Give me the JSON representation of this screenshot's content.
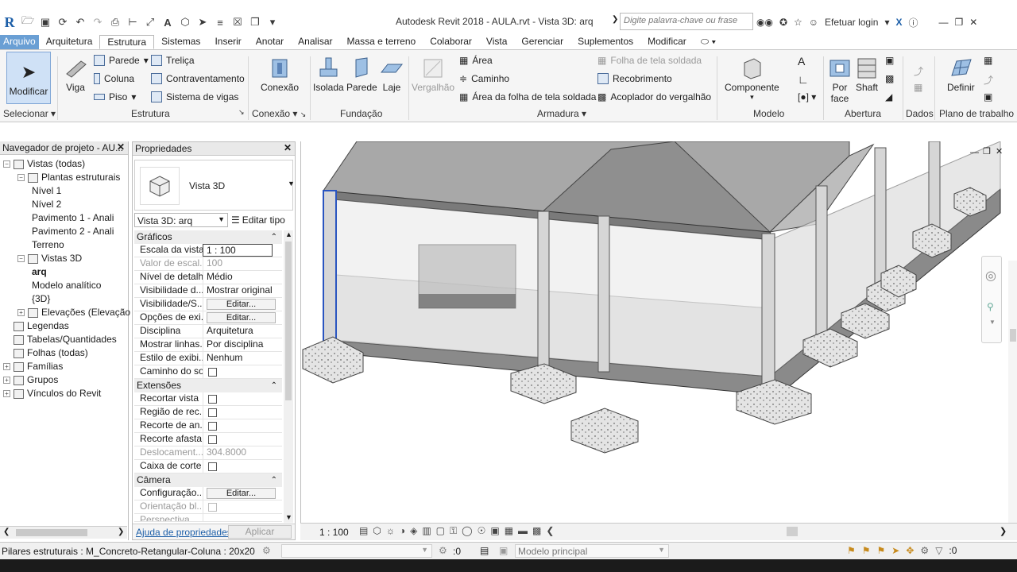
{
  "title": {
    "document": "Autodesk Revit 2018 -    AULA.rvt - Vista 3D: arq",
    "search_placeholder": "Digite palavra-chave ou frase",
    "login": "Efetuar login"
  },
  "tabs": [
    "Arquivo",
    "Arquitetura",
    "Estrutura",
    "Sistemas",
    "Inserir",
    "Anotar",
    "Analisar",
    "Massa e terreno",
    "Colaborar",
    "Vista",
    "Gerenciar",
    "Suplementos",
    "Modificar"
  ],
  "active_tab": "Estrutura",
  "ribbon": {
    "modificar": "Modificar",
    "selecionar": "Selecionar",
    "viga": "Viga",
    "parede": "Parede",
    "coluna": "Coluna",
    "piso": "Piso",
    "trelica": "Treliça",
    "contraventamento": "Contraventamento",
    "sistema_vigas": "Sistema de  vigas",
    "estrutura": "Estrutura",
    "conexao": "Conexão",
    "conexao_panel": "Conexão",
    "isolada": "Isolada",
    "parede_fund": "Parede",
    "laje": "Laje",
    "fundacao": "Fundação",
    "vergalhao": "Vergalhão",
    "area": "Área",
    "caminho": "Caminho",
    "area_tela": "Área  da folha de tela soldada",
    "folha_tela": "Folha de tela soldada",
    "recobrimento": "Recobrimento",
    "acoplador": "Acoplador do  vergalhão",
    "armadura": "Armadura",
    "componente": "Componente",
    "modelo": "Modelo",
    "por_face": "Por face",
    "shaft": "Shaft",
    "abertura": "Abertura",
    "dados": "Dados",
    "definir": "Definir",
    "plano_trabalho": "Plano de trabalho"
  },
  "browser": {
    "title": "Navegador de projeto - AU...",
    "items": [
      {
        "label": "Vistas (todas)",
        "level": 0,
        "toggle": "−"
      },
      {
        "label": "Plantas estruturais",
        "level": 1,
        "toggle": "−"
      },
      {
        "label": "Nível 1",
        "level": 2
      },
      {
        "label": "Nível 2",
        "level": 2
      },
      {
        "label": "Pavimento 1 - Anali",
        "level": 2
      },
      {
        "label": "Pavimento 2 - Anali",
        "level": 2
      },
      {
        "label": "Terreno",
        "level": 2
      },
      {
        "label": "Vistas 3D",
        "level": 1,
        "toggle": "−"
      },
      {
        "label": "arq",
        "level": 2,
        "bold": true
      },
      {
        "label": "Modelo analítico",
        "level": 2
      },
      {
        "label": "{3D}",
        "level": 2
      },
      {
        "label": "Elevações (Elevação da e",
        "level": 1,
        "toggle": "+"
      },
      {
        "label": "Legendas",
        "level": 0
      },
      {
        "label": "Tabelas/Quantidades",
        "level": 0
      },
      {
        "label": "Folhas (todas)",
        "level": 0
      },
      {
        "label": "Famílias",
        "level": 0,
        "toggle": "+"
      },
      {
        "label": "Grupos",
        "level": 0,
        "toggle": "+"
      },
      {
        "label": "Vínculos do Revit",
        "level": 0,
        "toggle": "+"
      }
    ]
  },
  "properties": {
    "title": "Propriedades",
    "type_name": "Vista 3D",
    "instance_select": "Vista 3D: arq",
    "edit_type": "Editar tipo",
    "groups": {
      "graficos": "Gráficos",
      "extensoes": "Extensões",
      "camera": "Câmera"
    },
    "rows": {
      "escala": {
        "k": "Escala da vista",
        "v": "1 : 100"
      },
      "valor_escala": {
        "k": "Valor de escal...",
        "v": "100"
      },
      "nivel_detalhe": {
        "k": "Nível de detalhe",
        "v": "Médio"
      },
      "visibilidade_d": {
        "k": "Visibilidade d...",
        "v": "Mostrar original"
      },
      "visibilidade_s": {
        "k": "Visibilidade/S...",
        "v": "Editar..."
      },
      "opcoes_exi": {
        "k": "Opções de exi...",
        "v": "Editar..."
      },
      "disciplina": {
        "k": "Disciplina",
        "v": "Arquitetura"
      },
      "mostrar_linhas": {
        "k": "Mostrar linhas...",
        "v": "Por disciplina"
      },
      "estilo_exi": {
        "k": "Estilo de exibi...",
        "v": "Nenhum"
      },
      "caminho_sol": {
        "k": "Caminho do sol",
        "v": ""
      },
      "recortar_vista": {
        "k": "Recortar vista",
        "v": ""
      },
      "regiao_rec": {
        "k": "Região de rec...",
        "v": ""
      },
      "recorte_an": {
        "k": "Recorte de an...",
        "v": ""
      },
      "recorte_afasta": {
        "k": "Recorte afasta...",
        "v": ""
      },
      "deslocament": {
        "k": "Deslocament...",
        "v": "304.8000"
      },
      "caixa_corte": {
        "k": "Caixa de corte",
        "v": ""
      },
      "configuracao": {
        "k": "Configuração...",
        "v": "Editar..."
      },
      "orientacao": {
        "k": "Orientação bl...",
        "v": ""
      },
      "perspectiva": {
        "k": "Perspectiva",
        "v": ""
      }
    },
    "help_link": "Ajuda de propriedades",
    "apply": "Aplicar"
  },
  "viewbar": {
    "scale": "1 : 100"
  },
  "status": {
    "text": "Pilares estruturais : M_Concreto-Retangular-Coluna : 20x20",
    "count": ":0",
    "model": "Modelo principal",
    "filter_count": ":0"
  },
  "colors": {
    "accent": "#1d5fa8",
    "active_button": "#cfe1f6",
    "file_tab": "#6a9fd4"
  }
}
